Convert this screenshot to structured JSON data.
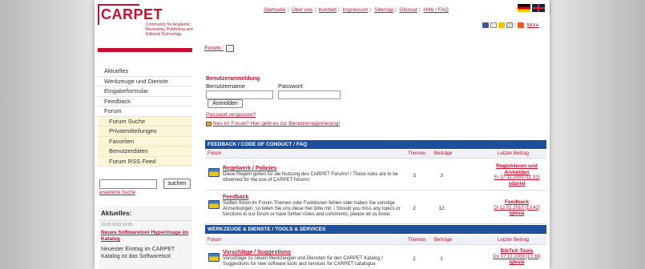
{
  "header": {
    "logo_text": "CARPET",
    "logo_subtitle": "Community for Academic Reviewing, Publishing and Editorial Technology",
    "top_links": [
      "Startseite",
      "Über uns",
      "Kontakt",
      "Impressum",
      "Sitemap",
      "Glossar",
      "Hilfe / FAQ"
    ],
    "tools_more": "More",
    "breadcrumb": "Forum :"
  },
  "nav": {
    "items": [
      {
        "label": "Aktuelles"
      },
      {
        "label": "Werkzeuge und Dienste"
      },
      {
        "label": "Eingabeformular"
      },
      {
        "label": "Feedback"
      },
      {
        "label": "Forum"
      }
    ],
    "sub_items": [
      {
        "label": "Forum Suche"
      },
      {
        "label": "Privatmitteilungen"
      },
      {
        "label": "Favoriten"
      },
      {
        "label": "Benutzerdaten"
      },
      {
        "label": "Forum RSS Feed"
      }
    ]
  },
  "search": {
    "button": "suchen",
    "advanced": "erweiterte Suche"
  },
  "news": {
    "title": "Aktuelles:",
    "date": "10.02.2010 16:28",
    "link": "Neues Softwaretool Hyperimage im Katalog",
    "text": "Neuester Eintrag im CARPET Katalog ist das Softwaretool"
  },
  "login": {
    "title": "Benutzeranmeldung",
    "username_label": "Benutzername",
    "password_label": "Passwort",
    "button": "Anmelden",
    "forgot": "Passwort vergessen?",
    "register": "Neu im Forum? Hier geht es zur Benutzerregistrierung!"
  },
  "columns": {
    "forum": "Forum",
    "threads": "Themen",
    "posts": "Beiträge",
    "last": "Letzter Beitrag"
  },
  "sections": [
    {
      "title": "FEEDBACK / CODE OF CONDUCT / FAQ",
      "rows": [
        {
          "title": "Regelwerk / Policies",
          "desc": "Diese Regeln gelten für die Nutzung des CARPET Forums! / These rules are to be observed for the use of CARPET forums!",
          "threads": "3",
          "posts": "3",
          "last_title": "Registrieren und Anmelden",
          "last_date": "Fr 27.11.2009 [11:31]",
          "last_user": "sdaniel"
        },
        {
          "title": "Feedback",
          "desc": "Sollten Ihnen im Forum Themen oder Funktionen fehlen oder haben Sie sonstige Anmerkungen, so teilen Sie uns diese hier bitte mit. / Should you miss any topics or functions in our forum or have further notes and comments, please let us know.",
          "threads": "2",
          "posts": "12",
          "last_title": "Feedback",
          "last_date": "Di 12.01.2010 [13:42]",
          "last_user": "iglesia"
        }
      ]
    },
    {
      "title": "WERKZEUGE & DIENSTE / TOOLS & SERVICES",
      "rows": [
        {
          "title": "Vorschläge / Suggestions",
          "desc": "Vorschläge zu neuen Werkzeugen und Diensten für den CARPET Katalog / Suggestions for new software tools and services for CARPET catalogue",
          "threads": "2",
          "posts": "1",
          "last_title": "BibTeX-Tools",
          "last_date": "Do 17.12.2009 [13:36]",
          "last_user": "iglesia"
        }
      ]
    }
  ],
  "colors": {
    "brand_red": "#c8102e",
    "section_blue": "#1e4f9c",
    "nav_sub_bg": "#fbf6d8"
  }
}
